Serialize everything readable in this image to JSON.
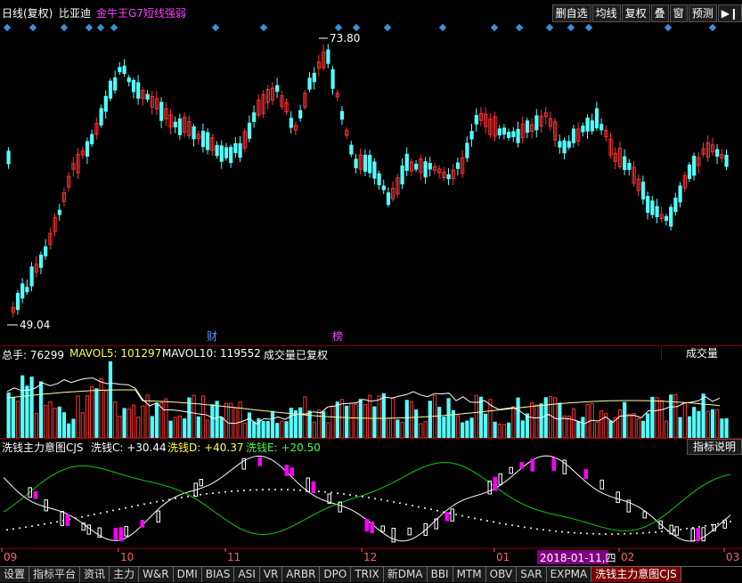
{
  "header": {
    "period": "日线(复权)",
    "stock_name": "比亚迪",
    "indicator": "金牛王G7短线强弱"
  },
  "toolbar": [
    "删自选",
    "均线",
    "复权",
    "叠",
    "窗",
    "预测"
  ],
  "price_chart": {
    "high_label": "73.80",
    "low_label": "49.04",
    "marker_cai": "财",
    "marker_bang": "榜"
  },
  "volume_panel": {
    "title": "总手: 76299",
    "mavol5": "MAVOL5: 101297",
    "mavol10": "MAVOL10: 119552",
    "note": "成交量已复权",
    "button": "成交量"
  },
  "cjs_panel": {
    "title": "洗钱主力意图CJS",
    "c": "洗钱C: +30.44",
    "d": "洗钱D: +40.37",
    "e": "洗钱E: +20.50",
    "button": "指标说明"
  },
  "x_axis": {
    "labels": [
      "09",
      "10",
      "11",
      "12",
      "01",
      "02",
      "03"
    ],
    "highlight_date": "2018-01-11,四"
  },
  "tabs": [
    "设置",
    "指标平台",
    "资讯",
    "主力",
    "W&R",
    "DMI",
    "BIAS",
    "ASI",
    "VR",
    "ARBR",
    "DPO",
    "TRIX",
    "新DMA",
    "BBI",
    "MTM",
    "OBV",
    "SAR",
    "EXPMA",
    "洗钱主力意图CJS"
  ],
  "active_tab": "洗钱主力意图CJS",
  "colors": {
    "up": "#ff3232",
    "down": "#54ffff",
    "white": "#ffffff",
    "yellow": "#ffff00",
    "green": "#00d000",
    "magenta": "#ff00ff"
  }
}
